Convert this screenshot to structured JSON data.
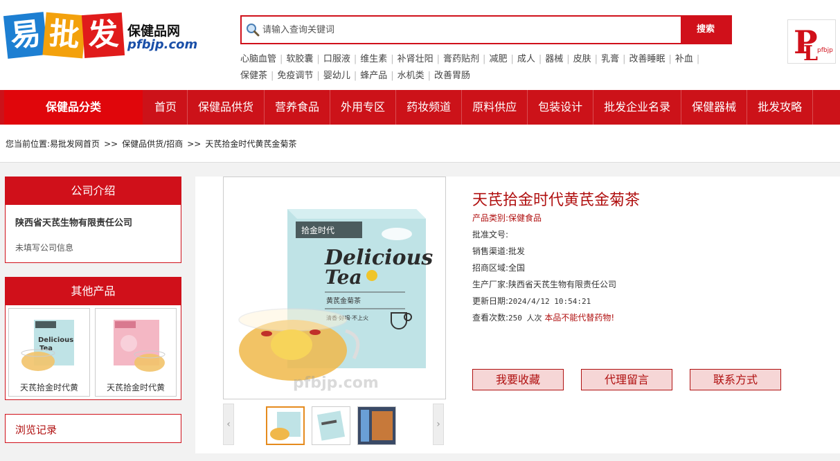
{
  "logo": {
    "chars": [
      "易",
      "批",
      "发"
    ],
    "subtitle": "保健品网",
    "domain": "pfbjp.com"
  },
  "search": {
    "placeholder": "请输入查询关键词",
    "button": "搜索"
  },
  "hotwords": [
    "心脑血管",
    "软胶囊",
    "口服液",
    "维生素",
    "补肾壮阳",
    "膏药贴剂",
    "减肥",
    "成人",
    "器械",
    "皮肤",
    "乳膏",
    "改善睡眠",
    "补血",
    "保健茶",
    "免疫调节",
    "婴幼儿",
    "蜂产品",
    "水机类",
    "改善胃肠"
  ],
  "brand_logo": {
    "text": "pfbjp"
  },
  "nav": {
    "category": "保健品分类",
    "items": [
      "首页",
      "保健品供货",
      "营养食品",
      "外用专区",
      "药妆频道",
      "原料供应",
      "包装设计",
      "批发企业名录",
      "保健器械",
      "批发攻略"
    ]
  },
  "breadcrumb": {
    "label": "您当前位置:",
    "items": [
      "易批发网首页",
      "保健品供货/招商",
      "天芪拾金时代黄芪金菊茶"
    ],
    "sep": ">>"
  },
  "sidebar": {
    "intro_title": "公司介绍",
    "company": "陕西省天芪生物有限责任公司",
    "company_info": "未填写公司信息",
    "others_title": "其他产品",
    "other_products": [
      "天芪拾金时代黄",
      "天芪拾金时代黄"
    ],
    "history_title": "浏览记录"
  },
  "product": {
    "title": "天芪拾金时代黄芪金菊茶",
    "category_label": "产品类别:",
    "category": "保健食品",
    "approval_label": "批准文号:",
    "approval": "",
    "channel_label": "销售渠道:",
    "channel": "批发",
    "region_label": "招商区域:",
    "region": "全国",
    "maker_label": "生产厂家:",
    "maker": "陕西省天芪生物有限责任公司",
    "updated_label": "更新日期:",
    "updated": "2024/4/12 10:54:21",
    "views_label": "查看次数:",
    "views": "250 人次",
    "warning": "本品不能代替药物!",
    "box_brand": "拾金时代",
    "box_title1": "Delicious",
    "box_title2": "Tea",
    "box_cn": "黄芪金菊茶",
    "box_slogan": "清香·好喝·不上火",
    "watermark": "pfbjp.com"
  },
  "actions": [
    "我要收藏",
    "代理留言",
    "联系方式"
  ],
  "colors": {
    "primary": "#cc1219",
    "accent": "#b01010",
    "box": "#bfe3e6"
  }
}
